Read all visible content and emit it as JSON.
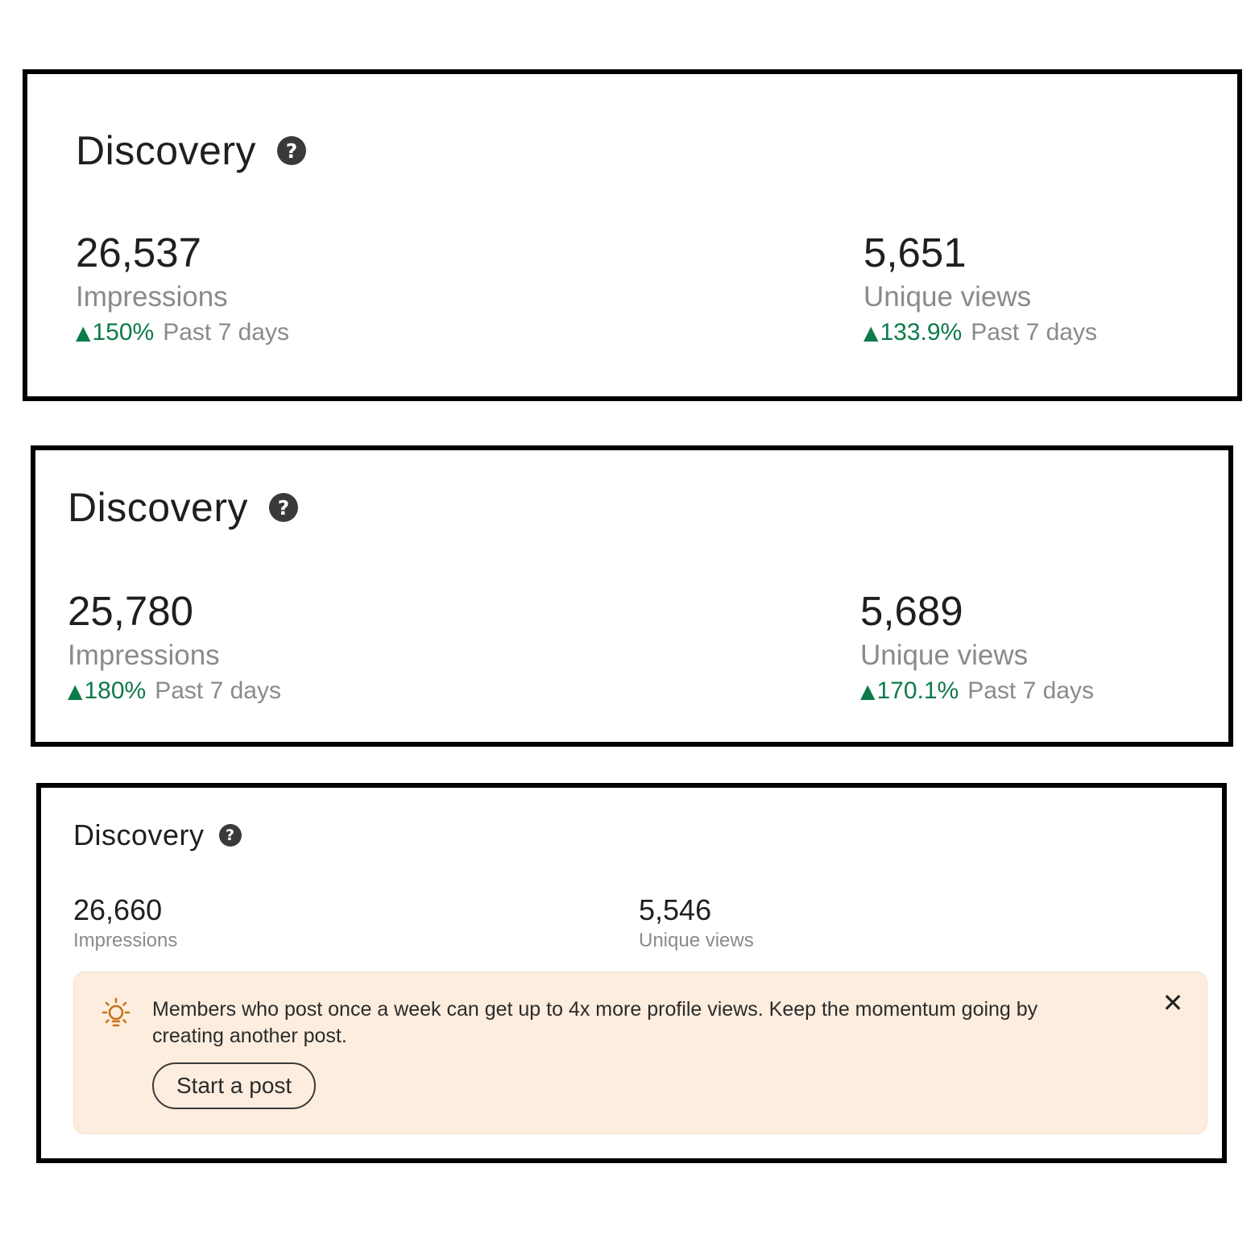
{
  "cards": [
    {
      "title": "Discovery",
      "help_icon": "question-circle-icon",
      "impressions": {
        "value": "26,537",
        "label": "Impressions",
        "change": "150%",
        "period": "Past 7 days",
        "trend_icon": "triangle-up-icon"
      },
      "unique_views": {
        "value": "5,651",
        "label": "Unique views",
        "change": "133.9%",
        "period": "Past 7 days",
        "trend_icon": "triangle-up-icon"
      }
    },
    {
      "title": "Discovery",
      "help_icon": "question-circle-icon",
      "impressions": {
        "value": "25,780",
        "label": "Impressions",
        "change": "180%",
        "period": "Past 7 days",
        "trend_icon": "triangle-up-icon"
      },
      "unique_views": {
        "value": "5,689",
        "label": "Unique views",
        "change": "170.1%",
        "period": "Past 7 days",
        "trend_icon": "triangle-up-icon"
      }
    },
    {
      "title": "Discovery",
      "help_icon": "question-circle-icon",
      "impressions": {
        "value": "26,660",
        "label": "Impressions"
      },
      "unique_views": {
        "value": "5,546",
        "label": "Unique views"
      },
      "tip": {
        "icon": "lightbulb-icon",
        "message": "Members who post once a week can get up to 4x more profile views. Keep the momentum going by creating another post.",
        "button_label": "Start a post",
        "close_icon": "close-icon"
      }
    }
  ],
  "colors": {
    "positive": "#0d7a4a",
    "muted_text": "#8a8a8a",
    "tip_background": "#fcedde",
    "border": "#000000"
  }
}
